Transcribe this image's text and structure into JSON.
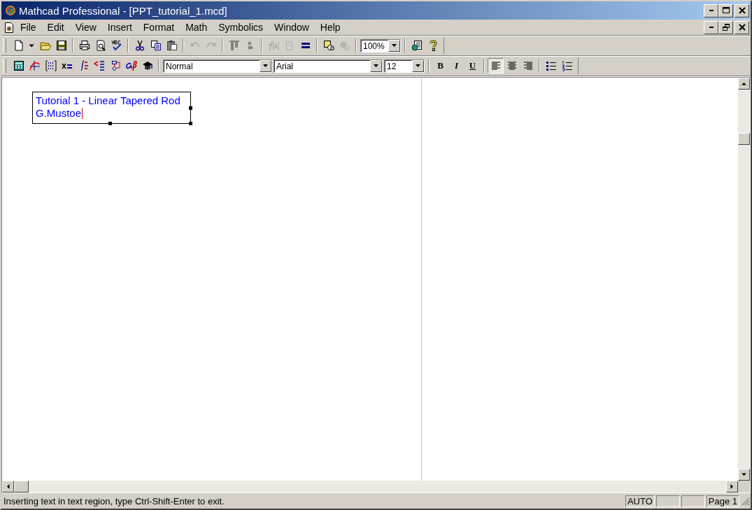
{
  "window": {
    "title": "Mathcad Professional - [PPT_tutorial_1.mcd]"
  },
  "menu": [
    {
      "label": "File"
    },
    {
      "label": "Edit"
    },
    {
      "label": "View"
    },
    {
      "label": "Insert"
    },
    {
      "label": "Format"
    },
    {
      "label": "Math"
    },
    {
      "label": "Symbolics"
    },
    {
      "label": "Window"
    },
    {
      "label": "Help"
    }
  ],
  "standard_toolbar": [
    {
      "kind": "button",
      "disabled": false
    },
    {
      "kind": "button",
      "disabled": false
    },
    {
      "kind": "button",
      "disabled": false
    },
    {
      "kind": "button",
      "disabled": false
    },
    {
      "kind": "separator"
    },
    {
      "kind": "button",
      "disabled": false
    },
    {
      "kind": "button",
      "disabled": false
    },
    {
      "kind": "button",
      "disabled": false
    },
    {
      "kind": "separator"
    },
    {
      "kind": "button",
      "disabled": false
    },
    {
      "kind": "button",
      "disabled": false
    },
    {
      "kind": "button",
      "disabled": false
    },
    {
      "kind": "separator"
    },
    {
      "kind": "button",
      "disabled": true
    },
    {
      "kind": "button",
      "disabled": true
    },
    {
      "kind": "separator"
    },
    {
      "kind": "button",
      "disabled": true
    },
    {
      "kind": "button",
      "disabled": true
    },
    {
      "kind": "separator"
    },
    {
      "kind": "button",
      "disabled": true
    },
    {
      "kind": "button",
      "disabled": true
    },
    {
      "kind": "button",
      "disabled": false
    },
    {
      "kind": "separator"
    },
    {
      "kind": "button",
      "disabled": false
    },
    {
      "kind": "button",
      "disabled": true
    },
    {
      "kind": "separator"
    },
    {
      "kind": "dropdown",
      "value": "100%"
    },
    {
      "kind": "separator"
    },
    {
      "kind": "button",
      "disabled": false
    },
    {
      "kind": "button",
      "disabled": false
    }
  ],
  "formatting_toolbar": [
    {
      "kind": "button",
      "selected": false
    },
    {
      "kind": "button",
      "selected": false
    },
    {
      "kind": "button",
      "selected": false
    },
    {
      "kind": "button",
      "selected": false
    },
    {
      "kind": "button",
      "selected": false
    },
    {
      "kind": "button",
      "selected": false
    },
    {
      "kind": "button",
      "selected": false
    },
    {
      "kind": "button",
      "selected": false
    },
    {
      "kind": "button",
      "selected": false
    },
    {
      "kind": "separator"
    },
    {
      "kind": "dropdown",
      "value": "Normal"
    },
    {
      "kind": "dropdown",
      "value": "Arial"
    },
    {
      "kind": "dropdown",
      "value": "12"
    },
    {
      "kind": "separator"
    },
    {
      "kind": "text_button",
      "label": "B",
      "selected": false
    },
    {
      "kind": "text_button",
      "label": "I",
      "selected": false
    },
    {
      "kind": "text_button",
      "label": "U",
      "selected": false
    },
    {
      "kind": "separator"
    },
    {
      "kind": "button",
      "selected": true
    },
    {
      "kind": "button",
      "selected": false
    },
    {
      "kind": "button",
      "selected": false
    },
    {
      "kind": "separator"
    },
    {
      "kind": "button",
      "selected": false
    },
    {
      "kind": "button",
      "selected": false
    }
  ],
  "worksheet": {
    "text_region": {
      "lines": [
        "Tutorial 1 - Linear Tapered Rod",
        "G.Mustoe"
      ],
      "editing": true
    }
  },
  "status_bar": {
    "message": "Inserting text in text region, type Ctrl-Shift-Enter to exit.",
    "panels": [
      {
        "kind": "text",
        "label": "AUTO"
      },
      {
        "kind": "blank"
      },
      {
        "kind": "blank"
      },
      {
        "kind": "text",
        "label": "Page 1"
      }
    ]
  }
}
